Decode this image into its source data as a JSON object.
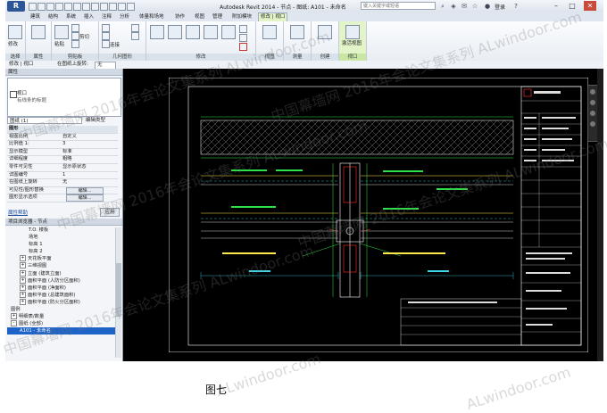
{
  "titlebar": {
    "app_button": "R",
    "title": "Autodesk Revit 2014 - 节点 - 图纸: A101 - 未命名",
    "search_placeholder": "键入关键字或短语",
    "login": "登录",
    "min": "–",
    "max": "□",
    "close": "✕"
  },
  "ribbon_tabs": [
    "建筑",
    "结构",
    "系统",
    "插入",
    "注释",
    "分析",
    "体量和场地",
    "协作",
    "视图",
    "管理",
    "附加模块",
    "修改 | 视口"
  ],
  "ribbon_groups": {
    "select": "选择",
    "properties": "属性",
    "clipboard": "剪贴板",
    "geometry": "几何图形",
    "modify": "修改",
    "view": "视图",
    "measure": "测量",
    "create": "创建",
    "viewport": "视口"
  },
  "ribbon_labels": {
    "modify": "修改",
    "paste": "粘贴",
    "cut": "剪切",
    "copy": "复制",
    "join": "连接",
    "activate_view": "激活视图"
  },
  "optionbar": {
    "context": "修改 | 视口",
    "rotation_label": "在图纸上旋转:",
    "rotation_value": "无"
  },
  "properties": {
    "title": "属性",
    "type_name": "视口",
    "type_sub": "有线条的标题",
    "instance": "图纸 (1)",
    "edit_type": "编辑类型",
    "rows": [
      {
        "k": "图形",
        "v": "",
        "hdr": true
      },
      {
        "k": "视图比例",
        "v": "自定义"
      },
      {
        "k": "比例值 1:",
        "v": "3"
      },
      {
        "k": "显示模型",
        "v": "标准"
      },
      {
        "k": "详细程度",
        "v": "粗略"
      },
      {
        "k": "零件可见性",
        "v": "显示原状态"
      },
      {
        "k": "详图编号",
        "v": "1"
      },
      {
        "k": "在图纸上旋转",
        "v": "无"
      },
      {
        "k": "可见性/图形替换",
        "btn": "编辑..."
      },
      {
        "k": "图形显示选项",
        "btn": "编辑..."
      }
    ],
    "help": "属性帮助",
    "apply": "应用"
  },
  "browser": {
    "title": "项目浏览器 - 节点",
    "items": [
      {
        "label": "T.O. 楼板",
        "indent": 2
      },
      {
        "label": "场地",
        "indent": 2
      },
      {
        "label": "标高 1",
        "indent": 2
      },
      {
        "label": "标高 2",
        "indent": 2
      },
      {
        "label": "天花板平面",
        "indent": 1,
        "exp": "+"
      },
      {
        "label": "三维视图",
        "indent": 1,
        "exp": "+"
      },
      {
        "label": "立面 (建筑立面)",
        "indent": 1,
        "exp": "+"
      },
      {
        "label": "面积平面 (人防分区面积)",
        "indent": 1,
        "exp": "+"
      },
      {
        "label": "面积平面 (净面积)",
        "indent": 1,
        "exp": "+"
      },
      {
        "label": "面积平面 (总建筑面积)",
        "indent": 1,
        "exp": "+"
      },
      {
        "label": "面积平面 (防火分区面积)",
        "indent": 1,
        "exp": "+"
      },
      {
        "label": "图例",
        "indent": 0,
        "exp": ""
      },
      {
        "label": "明细表/数量",
        "indent": 0,
        "exp": "+"
      },
      {
        "label": "图纸 (全部)",
        "indent": 0,
        "exp": "-"
      },
      {
        "label": "A101 - 未命名",
        "indent": 1,
        "exp": "",
        "sel": true
      }
    ]
  },
  "caption": "图七",
  "watermarks": [
    "中国幕墙网 2016年会论文集系列 ALwindoor.com",
    "中国幕墙网 2016年会论文集系列 ALwindoor.com",
    "中国幕墙网 2016年会论文集系列 ALwindoor.com",
    "中国幕墙网 2016年会论文集系列 ALwindoor.com",
    "中国幕墙网 2016年会论文集系列 ALwindoor.com",
    "ALwindoor.com",
    "ALwindoor.com"
  ],
  "colors": {
    "canvas": "#000000",
    "line_white": "#ffffff",
    "line_green": "#2ee04a",
    "line_red": "#ff3030",
    "line_yellow": "#ffe84a",
    "line_cyan": "#3fd8e8",
    "selection": "#1e64c8"
  }
}
